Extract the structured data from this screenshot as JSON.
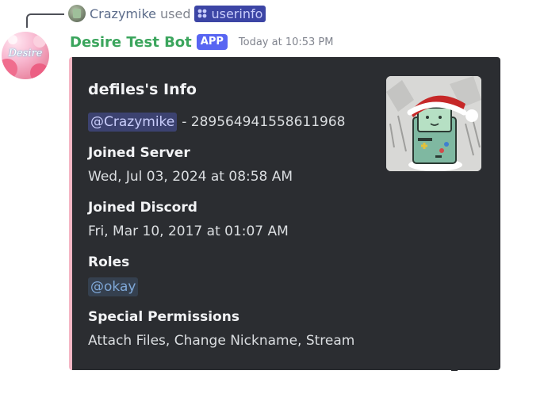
{
  "reply": {
    "username": "Crazymike",
    "used_text": "used",
    "command": "userinfo"
  },
  "message": {
    "bot_name": "Desire Test Bot",
    "badge": "APP",
    "timestamp": "Today at 10:53 PM",
    "avatar_text": "Desire"
  },
  "embed": {
    "title": "defiles's Info",
    "mention": "@Crazymike",
    "user_id_text": "- 289564941558611968",
    "fields": [
      {
        "name": "Joined Server",
        "value": "Wed, Jul 03, 2024 at 08:58 AM"
      },
      {
        "name": "Joined Discord",
        "value": "Fri, Mar 10, 2017 at 01:07 AM"
      },
      {
        "name": "Roles",
        "value": "@okay"
      },
      {
        "name": "Special Permissions",
        "value": "Attach Files, Change Nickname, Stream"
      }
    ],
    "accent_color": "#f5b7c5",
    "thumbnail_icon": "bmo-santa-hat-icon"
  },
  "colors": {
    "bot_name": "#3ba55d",
    "badge_bg": "#5865f2",
    "embed_bg": "#2b2d31",
    "mention_bg": "#3c4270",
    "mention_text": "#c9cdfb"
  }
}
